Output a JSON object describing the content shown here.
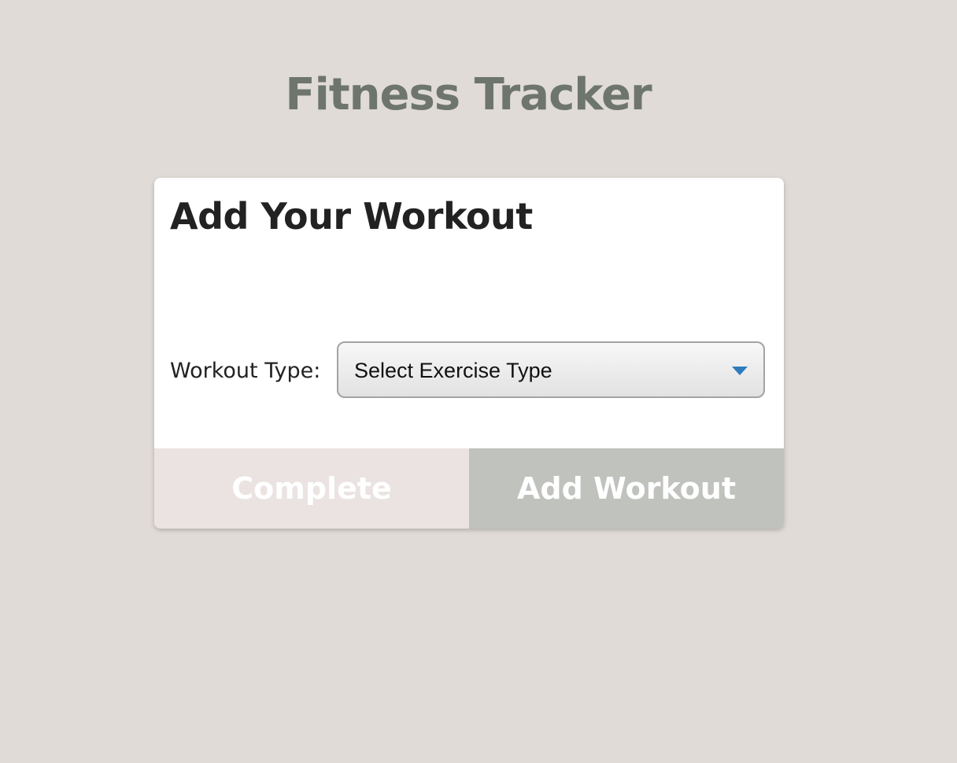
{
  "header": {
    "title": "Fitness Tracker"
  },
  "card": {
    "title": "Add Your Workout",
    "workout_type_label": "Workout Type:",
    "workout_type_select": {
      "selected": "Select Exercise Type"
    }
  },
  "actions": {
    "complete_label": "Complete",
    "add_workout_label": "Add Workout"
  },
  "colors": {
    "background": "#e0dbd6",
    "title_color": "#6e766b",
    "complete_button": "#eae3e2",
    "add_workout_button": "#c0c2bd",
    "dropdown_arrow": "#2f7bbd"
  },
  "icons": {
    "dropdown": "chevron-down-icon"
  }
}
